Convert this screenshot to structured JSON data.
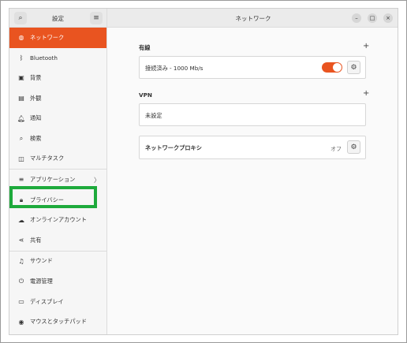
{
  "sidebar": {
    "title": "設定",
    "search_icon": "search-icon",
    "menu_icon": "hamburger-menu-icon",
    "items": [
      {
        "label": "ネットワーク",
        "icon": "network-icon",
        "glyph": "◍",
        "active": true
      },
      {
        "label": "Bluetooth",
        "icon": "bluetooth-icon",
        "glyph": "ᛒ"
      },
      {
        "label": "背景",
        "icon": "background-icon",
        "glyph": "▣"
      },
      {
        "label": "外観",
        "icon": "appearance-icon",
        "glyph": "▤"
      },
      {
        "label": "通知",
        "icon": "bell-icon",
        "glyph": "🔔︎"
      },
      {
        "label": "検索",
        "icon": "search-icon",
        "glyph": "⌕"
      },
      {
        "label": "マルチタスク",
        "icon": "multitasking-icon",
        "glyph": "◫"
      },
      {
        "label": "アプリケーション",
        "icon": "apps-icon",
        "glyph": "≡",
        "chevron": true
      },
      {
        "label": "プライバシー",
        "icon": "lock-icon",
        "glyph": "🔒︎",
        "chevron": true
      },
      {
        "label": "オンラインアカウント",
        "icon": "cloud-icon",
        "glyph": "☁"
      },
      {
        "label": "共有",
        "icon": "share-icon",
        "glyph": "⋖"
      },
      {
        "label": "サウンド",
        "icon": "music-note-icon",
        "glyph": "♫"
      },
      {
        "label": "電源管理",
        "icon": "power-icon",
        "glyph": "⏻"
      },
      {
        "label": "ディスプレイ",
        "icon": "display-icon",
        "glyph": "▭"
      },
      {
        "label": "マウスとタッチパッド",
        "icon": "mouse-icon",
        "glyph": "◉"
      }
    ]
  },
  "main": {
    "title": "ネットワーク",
    "window_buttons": {
      "minimize": "–",
      "maximize": "□",
      "close": "×"
    },
    "wired": {
      "label": "有線",
      "add": "+",
      "connection_text": "接続済み - 1000 Mb/s",
      "toggle_on": true
    },
    "vpn": {
      "label": "VPN",
      "add": "+",
      "status_text": "未設定"
    },
    "proxy": {
      "label": "ネットワークプロキシ",
      "status": "オフ"
    },
    "gear_glyph": "⚙"
  },
  "colors": {
    "accent": "#e95420",
    "highlight_box": "#1eaa3c"
  }
}
